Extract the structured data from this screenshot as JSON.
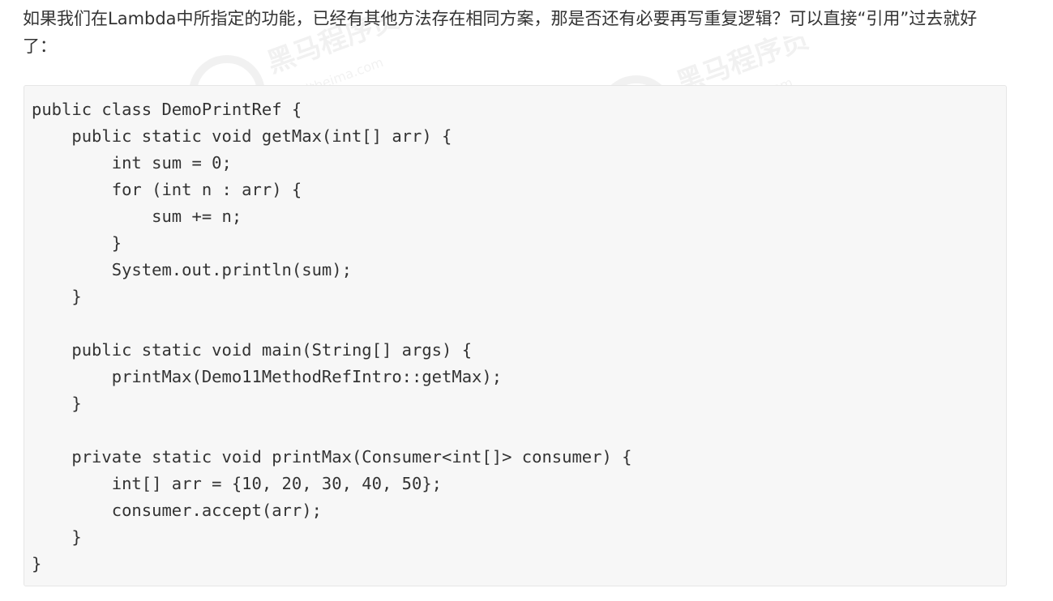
{
  "intro": {
    "text": "如果我们在Lambda中所指定的功能，已经有其他方法存在相同方案，那是否还有必要再写重复逻辑？可以直接“引用”过去就好了："
  },
  "code": {
    "language": "java",
    "lines": [
      "public class DemoPrintRef {",
      "    public static void getMax(int[] arr) {",
      "        int sum = 0;",
      "        for (int n : arr) {",
      "            sum += n;",
      "        }",
      "        System.out.println(sum);",
      "    }",
      "",
      "    public static void main(String[] args) {",
      "        printMax(Demo11MethodRefIntro::getMax);",
      "    }",
      "",
      "    private static void printMax(Consumer<int[]> consumer) {",
      "        int[] arr = {10, 20, 30, 40, 50};",
      "        consumer.accept(arr);",
      "    }",
      "}"
    ]
  },
  "watermark": {
    "cn": "黑马程序员",
    "url": "www.itheima.com"
  }
}
